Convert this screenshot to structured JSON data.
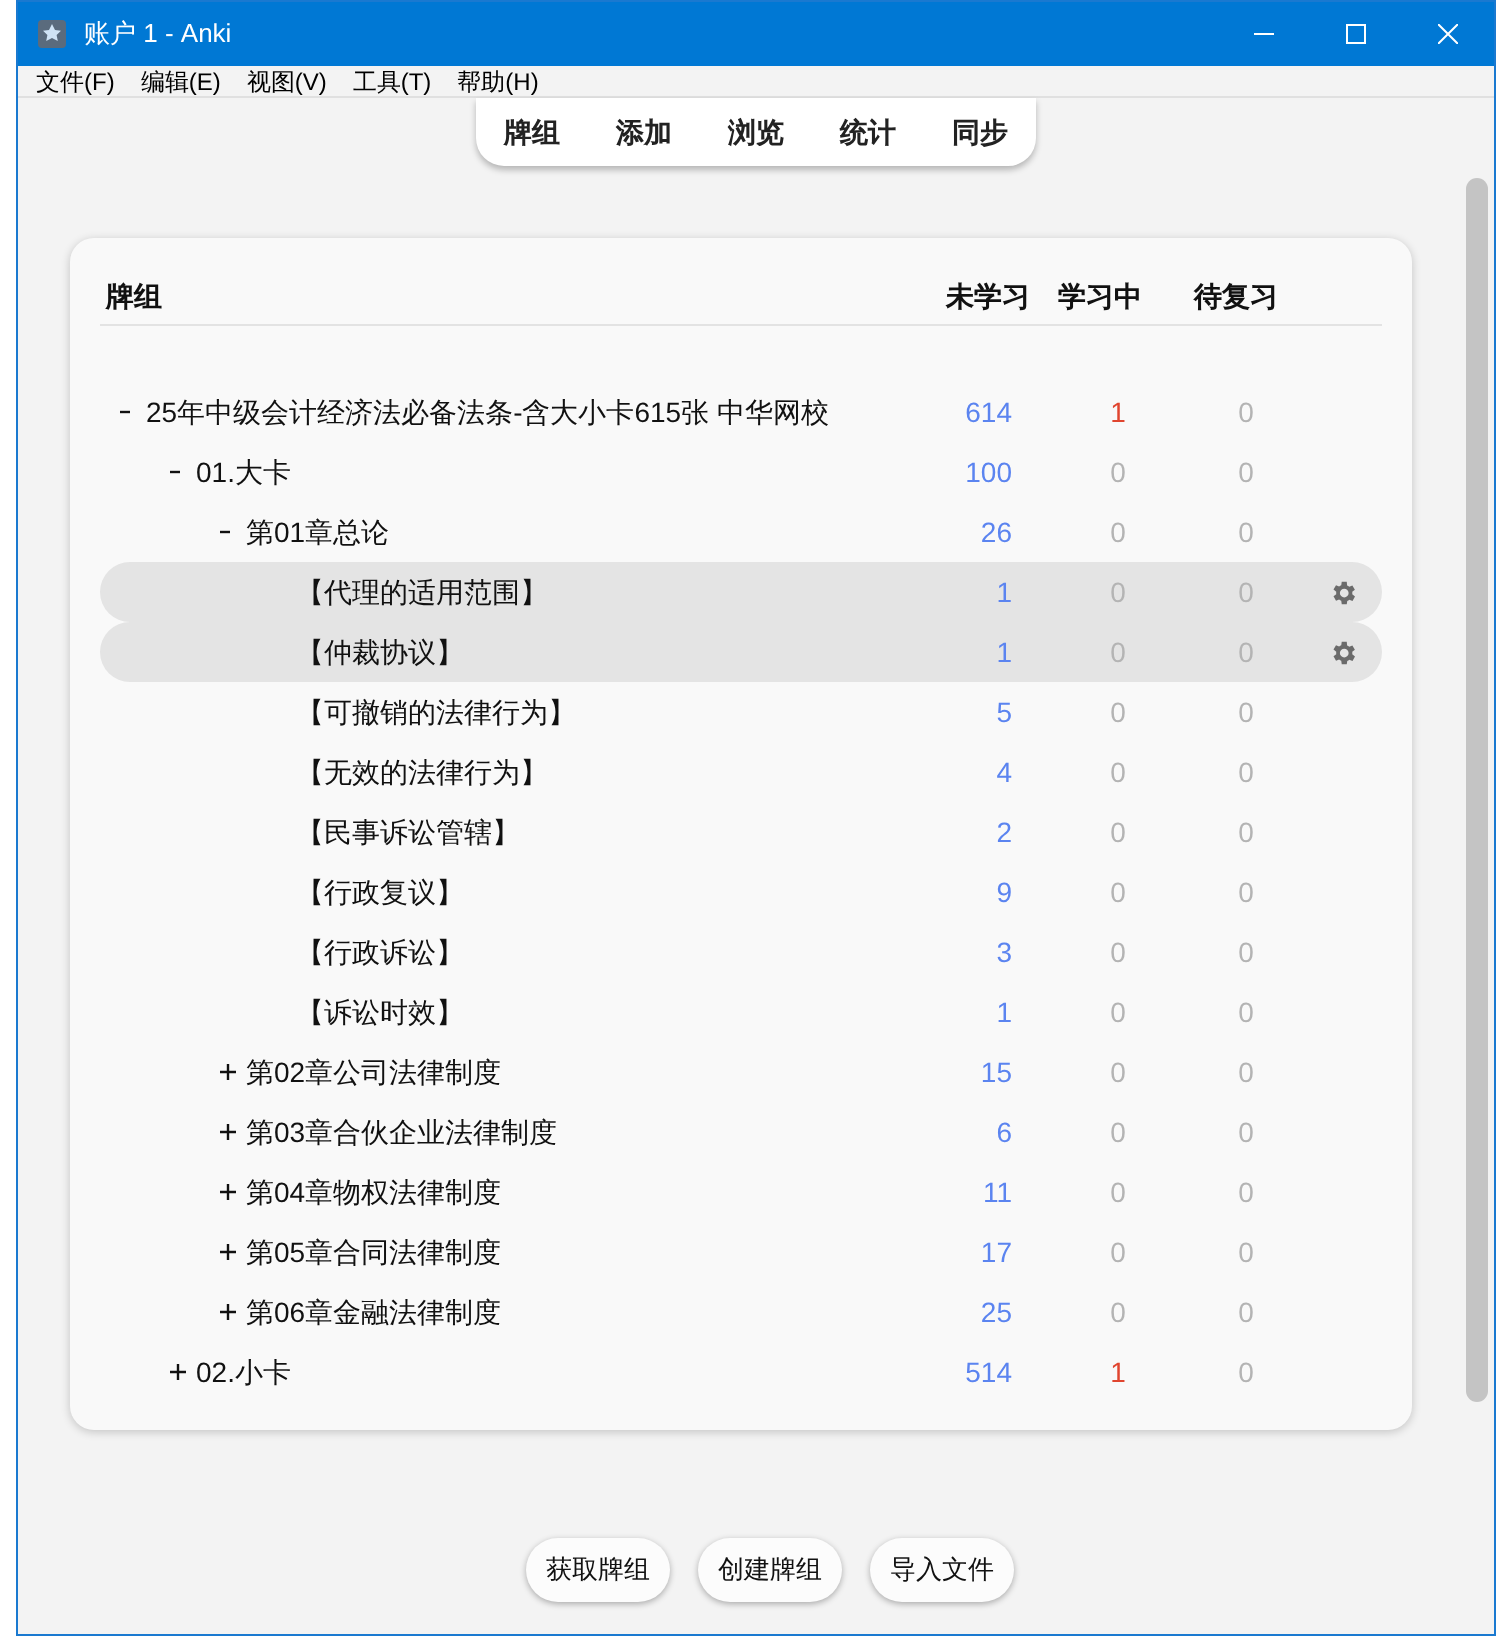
{
  "window": {
    "title": "账户 1 - Anki"
  },
  "menu": [
    "文件(F)",
    "编辑(E)",
    "视图(V)",
    "工具(T)",
    "帮助(H)"
  ],
  "toolbar": [
    "牌组",
    "添加",
    "浏览",
    "统计",
    "同步"
  ],
  "table": {
    "columns": [
      "牌组",
      "未学习",
      "学习中",
      "待复习"
    ],
    "decks": [
      {
        "name": "25年中级会计经济法必备法条-含大小卡615张 中华网校",
        "expanded": true,
        "selected": false,
        "new": "614",
        "learn": "1",
        "review": "0",
        "children": [
          {
            "name": "01.大卡",
            "expanded": true,
            "selected": false,
            "new": "100",
            "learn": "0",
            "review": "0",
            "children": [
              {
                "name": "第01章总论",
                "expanded": true,
                "selected": false,
                "new": "26",
                "learn": "0",
                "review": "0",
                "children": [
                  {
                    "name": "【代理的适用范围】",
                    "selected": true,
                    "new": "1",
                    "learn": "0",
                    "review": "0"
                  },
                  {
                    "name": "【仲裁协议】",
                    "selected": true,
                    "new": "1",
                    "learn": "0",
                    "review": "0"
                  },
                  {
                    "name": "【可撤销的法律行为】",
                    "selected": false,
                    "new": "5",
                    "learn": "0",
                    "review": "0"
                  },
                  {
                    "name": "【无效的法律行为】",
                    "selected": false,
                    "new": "4",
                    "learn": "0",
                    "review": "0"
                  },
                  {
                    "name": "【民事诉讼管辖】",
                    "selected": false,
                    "new": "2",
                    "learn": "0",
                    "review": "0"
                  },
                  {
                    "name": "【行政复议】",
                    "selected": false,
                    "new": "9",
                    "learn": "0",
                    "review": "0"
                  },
                  {
                    "name": "【行政诉讼】",
                    "selected": false,
                    "new": "3",
                    "learn": "0",
                    "review": "0"
                  },
                  {
                    "name": "【诉讼时效】",
                    "selected": false,
                    "new": "1",
                    "learn": "0",
                    "review": "0"
                  }
                ]
              },
              {
                "name": "第02章公司法律制度",
                "expanded": false,
                "selected": false,
                "new": "15",
                "learn": "0",
                "review": "0"
              },
              {
                "name": "第03章合伙企业法律制度",
                "expanded": false,
                "selected": false,
                "new": "6",
                "learn": "0",
                "review": "0"
              },
              {
                "name": "第04章物权法律制度",
                "expanded": false,
                "selected": false,
                "new": "11",
                "learn": "0",
                "review": "0"
              },
              {
                "name": "第05章合同法律制度",
                "expanded": false,
                "selected": false,
                "new": "17",
                "learn": "0",
                "review": "0"
              },
              {
                "name": "第06章金融法律制度",
                "expanded": false,
                "selected": false,
                "new": "25",
                "learn": "0",
                "review": "0"
              }
            ]
          },
          {
            "name": "02.小卡",
            "expanded": false,
            "selected": false,
            "new": "514",
            "learn": "1",
            "review": "0"
          }
        ]
      }
    ]
  },
  "buttons": [
    "获取牌组",
    "创建牌组",
    "导入文件"
  ]
}
